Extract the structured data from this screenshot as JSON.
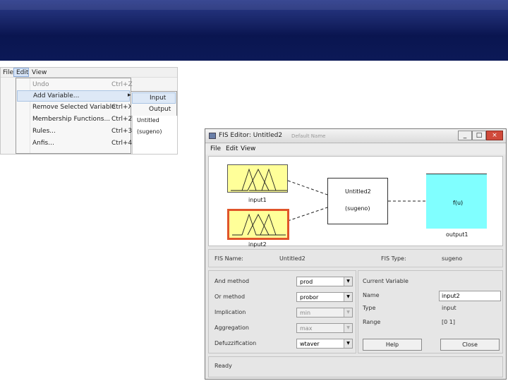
{
  "colors": {
    "banner": "#0a1550",
    "mf_yellow": "#ffff99",
    "output_cyan": "#80ffff",
    "selected_border": "#e0552a"
  },
  "menu_screenshot": {
    "menubar": [
      "File",
      "Edit",
      "View"
    ],
    "edit_menu": [
      {
        "label": "Undo",
        "shortcut": "Ctrl+Z"
      },
      {
        "label": "Add Variable...",
        "shortcut": "",
        "submenu": true
      },
      {
        "label": "Remove Selected Variable",
        "shortcut": "Ctrl+X"
      },
      {
        "label": "Membership Functions...",
        "shortcut": "Ctrl+2"
      },
      {
        "label": "Rules...",
        "shortcut": "Ctrl+3"
      },
      {
        "label": "Anfis...",
        "shortcut": "Ctrl+4"
      }
    ],
    "submenu": [
      "Input",
      "Output"
    ],
    "behind_text": [
      "Untitled",
      "(sugeno)"
    ]
  },
  "fis": {
    "title": "FIS Editor: Untitled2",
    "title_faded": "Default Name",
    "window_buttons": [
      "_",
      "□",
      "×"
    ],
    "menubar": [
      "File",
      "Edit",
      "View"
    ],
    "diagram": {
      "input1": "input1",
      "input2": "input2",
      "system_name": "Untitled2",
      "system_type": "(sugeno)",
      "output_func": "f(u)",
      "output1": "output1"
    },
    "info": {
      "fis_name_label": "FIS Name:",
      "fis_name": "Untitled2",
      "fis_type_label": "FIS Type:",
      "fis_type": "sugeno"
    },
    "methods": [
      {
        "label": "And method",
        "value": "prod",
        "enabled": true
      },
      {
        "label": "Or method",
        "value": "probor",
        "enabled": true
      },
      {
        "label": "Implication",
        "value": "min",
        "enabled": false
      },
      {
        "label": "Aggregation",
        "value": "max",
        "enabled": false
      },
      {
        "label": "Defuzzification",
        "value": "wtaver",
        "enabled": true
      }
    ],
    "current_variable": {
      "heading": "Current Variable",
      "name_label": "Name",
      "name_value": "input2",
      "type_label": "Type",
      "type_value": "input",
      "range_label": "Range",
      "range_value": "[0 1]"
    },
    "buttons": {
      "help": "Help",
      "close": "Close"
    },
    "status": "Ready"
  }
}
